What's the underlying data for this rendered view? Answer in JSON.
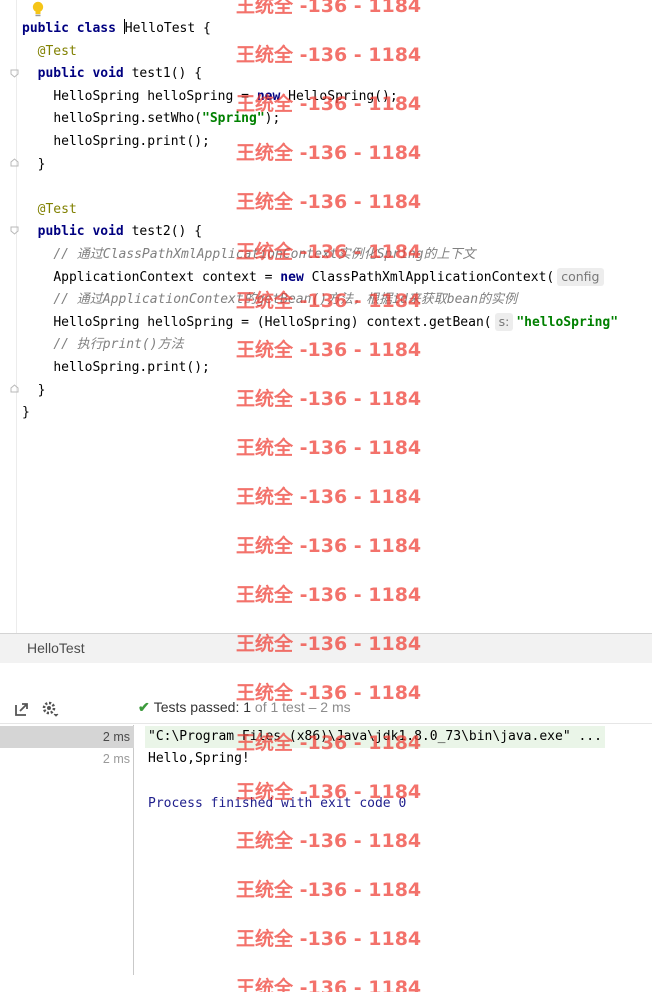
{
  "editor": {
    "lines": [
      {
        "type": "class_decl",
        "kw1": "public",
        "kw2": "class",
        "pre": "",
        "name": "HelloTest",
        "rest": " {"
      },
      {
        "type": "annotation",
        "text": "@Test"
      },
      {
        "type": "method_decl",
        "kw1": "public",
        "kw2": "void",
        "rest": " test1() {"
      },
      {
        "type": "new_stmt",
        "pre": "HelloSpring helloSpring = ",
        "kw": "new",
        "post": " HelloSpring();"
      },
      {
        "type": "str_stmt",
        "pre": "helloSpring.setWho(",
        "str": "\"Spring\"",
        "post": ");"
      },
      {
        "type": "plain",
        "text": "helloSpring.print();"
      },
      {
        "type": "plain_close",
        "text": "}"
      },
      {
        "type": "blank"
      },
      {
        "type": "annotation",
        "text": "@Test"
      },
      {
        "type": "method_decl",
        "kw1": "public",
        "kw2": "void",
        "rest": " test2() {"
      },
      {
        "type": "comment",
        "text": "// 通过ClassPathXmlApplicationContext实例化Spring的上下文"
      },
      {
        "type": "new_hint",
        "pre": "ApplicationContext context = ",
        "kw": "new",
        "post": " ClassPathXmlApplicationContext(",
        "hint": "config"
      },
      {
        "type": "comment",
        "text": "// 通过ApplicationContext的getBean()方法，根据id来获取bean的实例"
      },
      {
        "type": "hint_str",
        "pre": "HelloSpring helloSpring = (HelloSpring) context.getBean(",
        "hint": "s:",
        "str": "\"helloSpring\""
      },
      {
        "type": "comment",
        "text": "// 执行print()方法"
      },
      {
        "type": "plain",
        "text": "helloSpring.print();"
      },
      {
        "type": "plain_close",
        "text": "}"
      },
      {
        "type": "class_close",
        "text": "}"
      }
    ]
  },
  "run_tab": {
    "title": "HelloTest"
  },
  "toolbar": {
    "status_label": "Tests passed:",
    "passed_count": "1",
    "status_detail": "of 1 test – 2 ms"
  },
  "tree": {
    "rows": [
      {
        "time": "2 ms"
      },
      {
        "time": "2 ms"
      }
    ]
  },
  "console": {
    "command": "\"C:\\Program Files (x86)\\Java\\jdk1.8.0_73\\bin\\java.exe\" ...",
    "output": "Hello,Spring!",
    "exit": "Process finished with exit code 0"
  },
  "watermark": {
    "text": "王统全 -136 - 1184"
  },
  "icons": {
    "bulb": "lightbulb-icon",
    "export": "export-icon",
    "settings": "gear-icon",
    "check": "check-icon"
  },
  "colors": {
    "keyword": "#000080",
    "annotation": "#808000",
    "string": "#008000",
    "comment": "#808080",
    "watermark": "#ee3c32"
  }
}
